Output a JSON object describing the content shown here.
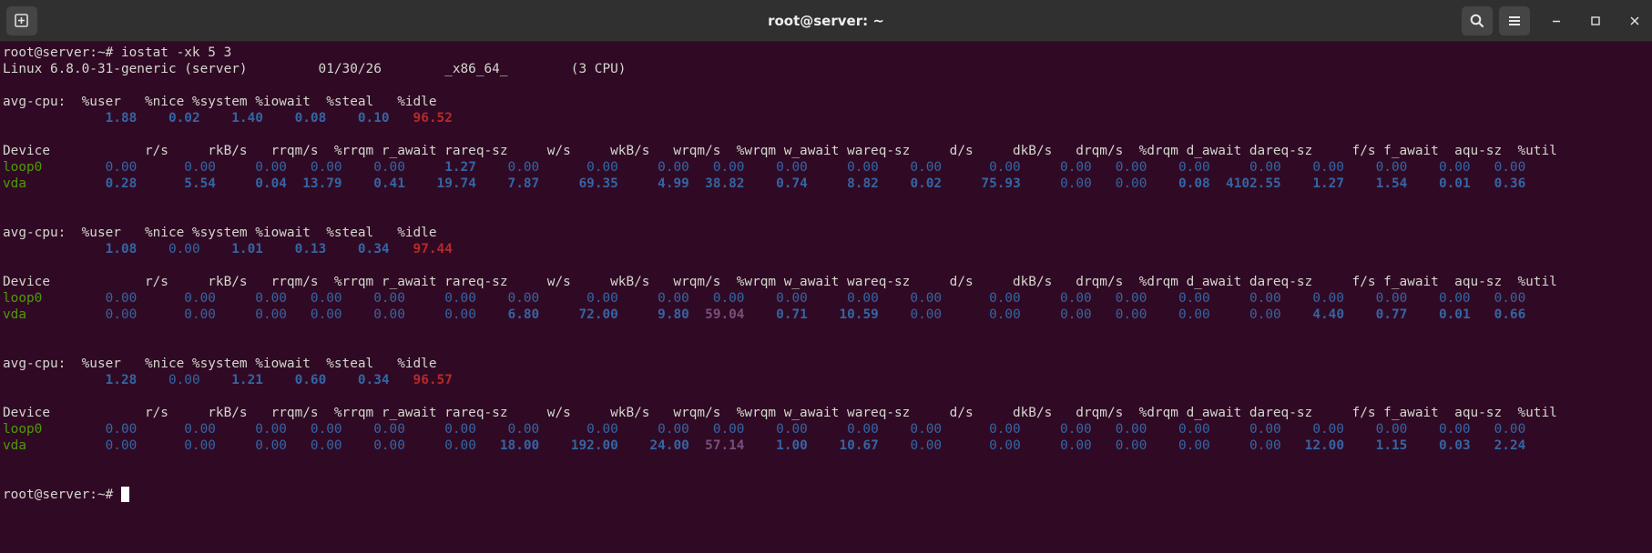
{
  "window": {
    "title": "root@server: ~"
  },
  "icons": {
    "new_tab": "new-tab-icon",
    "search": "search-icon",
    "menu": "hamburger-menu-icon",
    "minimize": "minimize-icon",
    "maximize": "maximize-icon",
    "close": "close-icon"
  },
  "colors": {
    "terminal_bg": "#300a24",
    "titlebar_bg": "#303030",
    "device_green": "#4e9a06",
    "value_blue": "#3465a4",
    "idle_red": "#b42a2a",
    "wrqm_magenta": "#75507b"
  },
  "terminal": {
    "prompt": "root@server:~#",
    "command": " iostat -xk 5 3",
    "sysinfo": "Linux 6.8.0-31-generic (server)         01/30/26        _x86_64_        (3 CPU)",
    "cpu_header": "avg-cpu:  %user   %nice %system %iowait  %steal   %idle",
    "dev_header": "Device            r/s     rkB/s   rrqm/s  %rrqm r_await rareq-sz     w/s     wkB/s   wrqm/s  %wrqm w_await wareq-sz     d/s     dkB/s   drqm/s  %drqm d_await dareq-sz     f/s f_await  aqu-sz  %util",
    "reports": [
      {
        "cpu": {
          "user": "1.88",
          "nice": "0.02",
          "system": "1.40",
          "iowait": "0.08",
          "steal": "0.10",
          "idle": "96.52"
        },
        "devices": [
          {
            "name": "loop0",
            "r_s": "0.00",
            "rkB_s": "0.00",
            "rrqm_s": "0.00",
            "rrqm_pct": "0.00",
            "r_await": "0.00",
            "rareq_sz": "1.27",
            "w_s": "0.00",
            "wkB_s": "0.00",
            "wrqm_s": "0.00",
            "wrqm_pct": "0.00",
            "w_await": "0.00",
            "wareq_sz": "0.00",
            "d_s": "0.00",
            "dkB_s": "0.00",
            "drqm_s": "0.00",
            "drqm_pct": "0.00",
            "d_await": "0.00",
            "dareq_sz": "0.00",
            "f_s": "0.00",
            "f_await": "0.00",
            "aqu_sz": "0.00",
            "util": "0.00"
          },
          {
            "name": "vda",
            "r_s": "0.28",
            "rkB_s": "5.54",
            "rrqm_s": "0.04",
            "rrqm_pct": "13.79",
            "r_await": "0.41",
            "rareq_sz": "19.74",
            "w_s": "7.87",
            "wkB_s": "69.35",
            "wrqm_s": "4.99",
            "wrqm_pct": "38.82",
            "w_await": "0.74",
            "wareq_sz": "8.82",
            "d_s": "0.02",
            "dkB_s": "75.93",
            "drqm_s": "0.00",
            "drqm_pct": "0.00",
            "d_await": "0.08",
            "dareq_sz": "4102.55",
            "f_s": "1.27",
            "f_await": "1.54",
            "aqu_sz": "0.01",
            "util": "0.36"
          }
        ]
      },
      {
        "cpu": {
          "user": "1.08",
          "nice": "0.00",
          "system": "1.01",
          "iowait": "0.13",
          "steal": "0.34",
          "idle": "97.44"
        },
        "devices": [
          {
            "name": "loop0",
            "r_s": "0.00",
            "rkB_s": "0.00",
            "rrqm_s": "0.00",
            "rrqm_pct": "0.00",
            "r_await": "0.00",
            "rareq_sz": "0.00",
            "w_s": "0.00",
            "wkB_s": "0.00",
            "wrqm_s": "0.00",
            "wrqm_pct": "0.00",
            "w_await": "0.00",
            "wareq_sz": "0.00",
            "d_s": "0.00",
            "dkB_s": "0.00",
            "drqm_s": "0.00",
            "drqm_pct": "0.00",
            "d_await": "0.00",
            "dareq_sz": "0.00",
            "f_s": "0.00",
            "f_await": "0.00",
            "aqu_sz": "0.00",
            "util": "0.00"
          },
          {
            "name": "vda",
            "r_s": "0.00",
            "rkB_s": "0.00",
            "rrqm_s": "0.00",
            "rrqm_pct": "0.00",
            "r_await": "0.00",
            "rareq_sz": "0.00",
            "w_s": "6.80",
            "wkB_s": "72.00",
            "wrqm_s": "9.80",
            "wrqm_pct": "59.04",
            "w_await": "0.71",
            "wareq_sz": "10.59",
            "d_s": "0.00",
            "dkB_s": "0.00",
            "drqm_s": "0.00",
            "drqm_pct": "0.00",
            "d_await": "0.00",
            "dareq_sz": "0.00",
            "f_s": "4.40",
            "f_await": "0.77",
            "aqu_sz": "0.01",
            "util": "0.66"
          }
        ]
      },
      {
        "cpu": {
          "user": "1.28",
          "nice": "0.00",
          "system": "1.21",
          "iowait": "0.60",
          "steal": "0.34",
          "idle": "96.57"
        },
        "devices": [
          {
            "name": "loop0",
            "r_s": "0.00",
            "rkB_s": "0.00",
            "rrqm_s": "0.00",
            "rrqm_pct": "0.00",
            "r_await": "0.00",
            "rareq_sz": "0.00",
            "w_s": "0.00",
            "wkB_s": "0.00",
            "wrqm_s": "0.00",
            "wrqm_pct": "0.00",
            "w_await": "0.00",
            "wareq_sz": "0.00",
            "d_s": "0.00",
            "dkB_s": "0.00",
            "drqm_s": "0.00",
            "drqm_pct": "0.00",
            "d_await": "0.00",
            "dareq_sz": "0.00",
            "f_s": "0.00",
            "f_await": "0.00",
            "aqu_sz": "0.00",
            "util": "0.00"
          },
          {
            "name": "vda",
            "r_s": "0.00",
            "rkB_s": "0.00",
            "rrqm_s": "0.00",
            "rrqm_pct": "0.00",
            "r_await": "0.00",
            "rareq_sz": "0.00",
            "w_s": "18.00",
            "wkB_s": "192.00",
            "wrqm_s": "24.00",
            "wrqm_pct": "57.14",
            "w_await": "1.00",
            "wareq_sz": "10.67",
            "d_s": "0.00",
            "dkB_s": "0.00",
            "drqm_s": "0.00",
            "drqm_pct": "0.00",
            "d_await": "0.00",
            "dareq_sz": "0.00",
            "f_s": "12.00",
            "f_await": "1.15",
            "aqu_sz": "0.03",
            "util": "2.24"
          }
        ]
      }
    ]
  }
}
